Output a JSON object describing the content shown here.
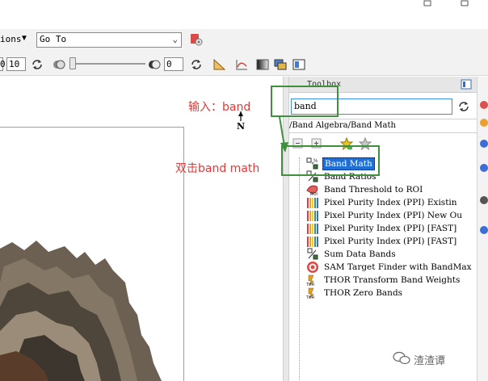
{
  "toolbar": {
    "options_label": "ions",
    "goto_value": "Go To",
    "left_value": "0",
    "box1_value": "10",
    "box2_value": "0"
  },
  "toolbox": {
    "title": "Toolbox",
    "search_value": "band",
    "path": "/Band Algebra/Band Math",
    "items": [
      {
        "label": "Band Math",
        "icon": "band-math-icon",
        "selected": true
      },
      {
        "label": "Band Ratios",
        "icon": "band-ratios-icon",
        "selected": false
      },
      {
        "label": "Band Threshold to ROI",
        "icon": "roi-icon",
        "selected": false
      },
      {
        "label": "Pixel Purity Index (PPI) Existin",
        "icon": "ppi-icon",
        "selected": false
      },
      {
        "label": "Pixel Purity Index (PPI) New Ou",
        "icon": "ppi-icon",
        "selected": false
      },
      {
        "label": "Pixel Purity Index (PPI) [FAST]",
        "icon": "ppi-icon",
        "selected": false
      },
      {
        "label": "Pixel Purity Index (PPI) [FAST]",
        "icon": "ppi-icon",
        "selected": false
      },
      {
        "label": "Sum Data Bands",
        "icon": "sum-bands-icon",
        "selected": false
      },
      {
        "label": "SAM Target Finder with BandMax",
        "icon": "target-icon",
        "selected": false
      },
      {
        "label": "THOR Transform Band Weights",
        "icon": "thor-icon",
        "selected": false
      },
      {
        "label": "THOR Zero Bands",
        "icon": "thor-icon",
        "selected": false
      }
    ]
  },
  "annotations": {
    "input_label": "输入：band",
    "doubleclick_label": "双击band math",
    "box_color": "#3f8f3f",
    "text_color": "#e03a3a"
  },
  "watermark": {
    "text": "渣渣谭"
  },
  "map": {
    "north_label": "N",
    "extent_color": "#3ec9c9"
  }
}
